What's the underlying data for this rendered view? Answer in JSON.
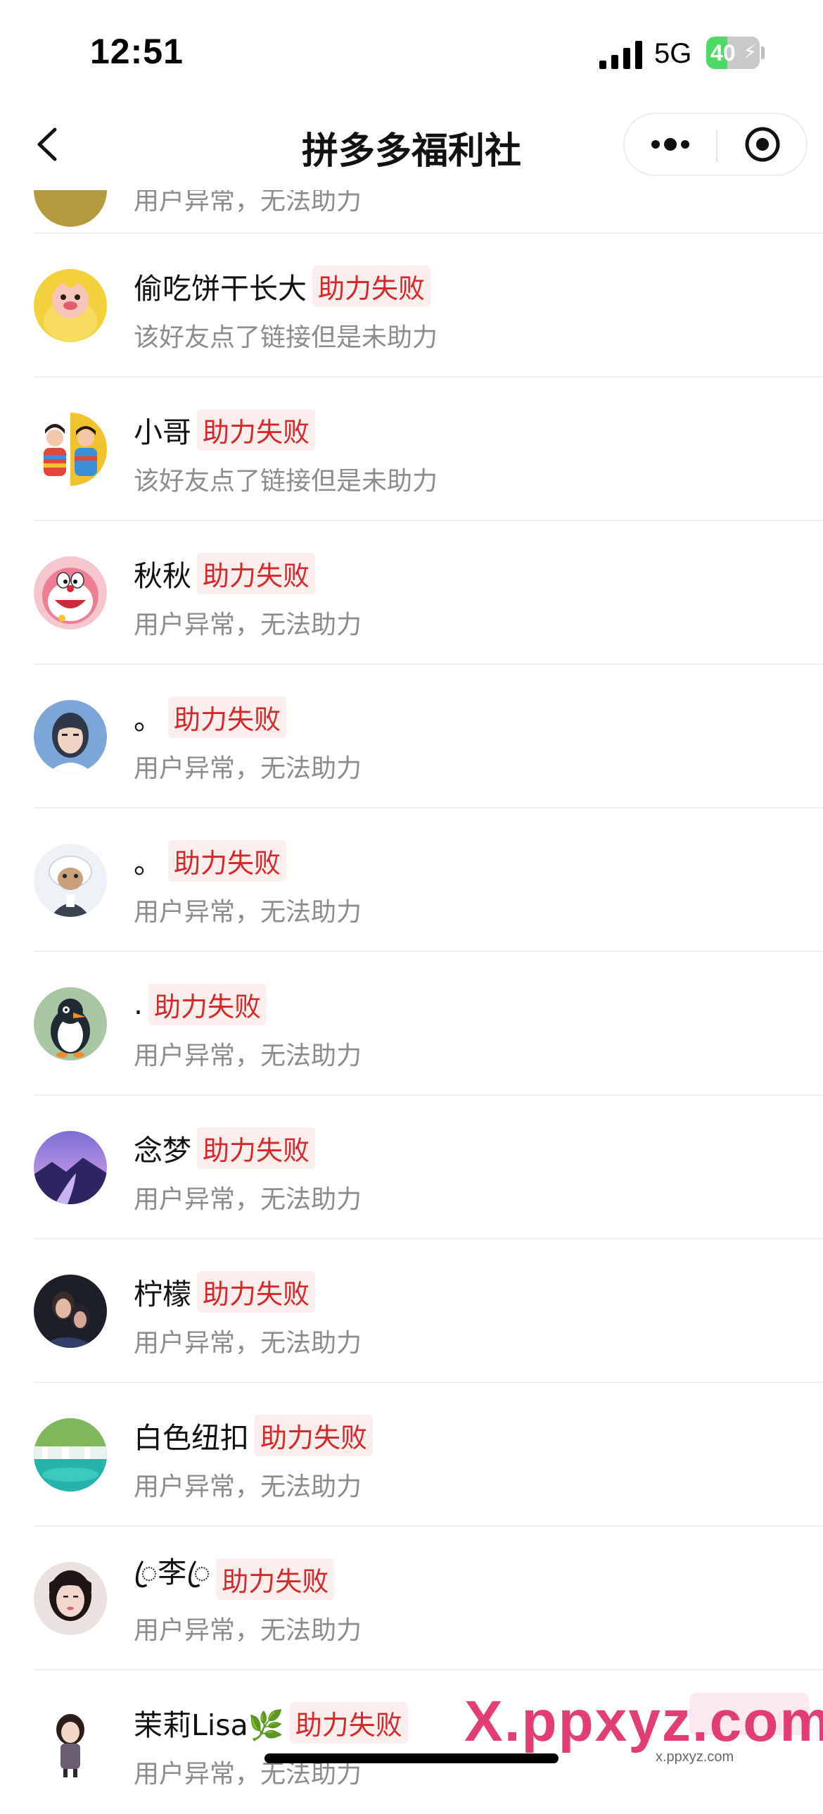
{
  "status_bar": {
    "time": "12:51",
    "network": "5G",
    "battery_level": "40",
    "battery_fraction": 0.4
  },
  "nav": {
    "title": "拼多多福利社",
    "back_icon": "chevron-left-icon",
    "more_icon": "more-dots-icon",
    "close_icon": "target-close-icon"
  },
  "partial_row": {
    "reason": "用户异常，无法助力"
  },
  "friends": [
    {
      "name": "偷吃饼干长大",
      "status": "助力失败",
      "reason": "该好友点了链接但是未助力",
      "avatar": "yellow-duck-avatar"
    },
    {
      "name": "小哥",
      "status": "助力失败",
      "reason": "该好友点了链接但是未助力",
      "avatar": "couple-avatar"
    },
    {
      "name": "秋秋",
      "status": "助力失败",
      "reason": "用户异常，无法助力",
      "avatar": "doraemon-avatar"
    },
    {
      "name": "。",
      "status": "助力失败",
      "reason": "用户异常，无法助力",
      "avatar": "anime-girl-avatar"
    },
    {
      "name": "。",
      "status": "助力失败",
      "reason": "用户异常，无法助力",
      "avatar": "cartoon-goat-avatar"
    },
    {
      "name": ".",
      "status": "助力失败",
      "reason": "用户异常，无法助力",
      "avatar": "penguin-avatar"
    },
    {
      "name": "念梦",
      "status": "助力失败",
      "reason": "用户异常，无法助力",
      "avatar": "landscape-avatar"
    },
    {
      "name": "柠檬",
      "status": "助力失败",
      "reason": "用户异常，无法助力",
      "avatar": "portrait-avatar"
    },
    {
      "name": "白色纽扣",
      "status": "助力失败",
      "reason": "用户异常，无法助力",
      "avatar": "waterfall-avatar"
    },
    {
      "name": "ꦿ李ꦿ",
      "status": "助力失败",
      "reason": "用户异常，无法助力",
      "avatar": "girl-photo-avatar"
    },
    {
      "name": "茉莉Lisa🌿",
      "status": "助力失败",
      "reason": "用户异常，无法助力",
      "avatar": "chibi-girl-avatar"
    }
  ],
  "watermark": {
    "text": "X.ppxyz.com",
    "sub": "x.ppxyz.com"
  },
  "colors": {
    "status_red": "#d4282b",
    "status_bg": "#fdeeee",
    "battery_green": "#4cd964",
    "reason_gray": "#8c8c8c"
  }
}
